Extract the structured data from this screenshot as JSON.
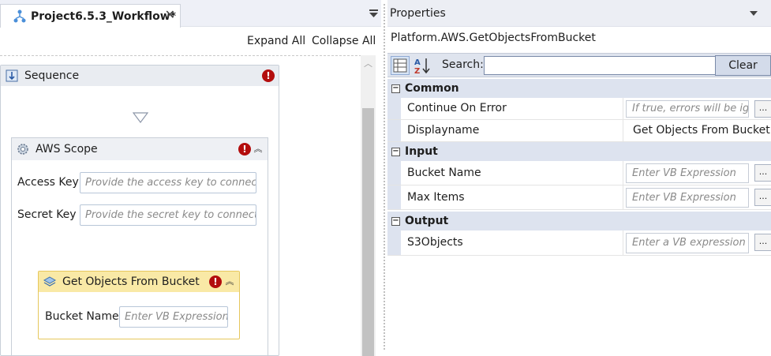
{
  "designer": {
    "tab_title": "Project6.5.3_Workflow*",
    "tab_close": "✕",
    "expand_all": "Expand All",
    "collapse_all": "Collapse All",
    "sequence": {
      "title": "Sequence"
    },
    "aws_scope": {
      "title": "AWS Scope",
      "access_key_label": "Access Key",
      "access_key_placeholder": "Provide the access key to connect",
      "secret_key_label": "Secret Key",
      "secret_key_placeholder": "Provide the secret key to connect"
    },
    "get_objects": {
      "title": "Get Objects From Bucket",
      "bucket_name_label": "Bucket Name",
      "bucket_name_placeholder": "Enter VB Expression"
    }
  },
  "properties": {
    "panel_title": "Properties",
    "activity_type": "Platform.AWS.GetObjectsFromBucket",
    "search_label": "Search:",
    "search_value": "",
    "clear_label": "Clear",
    "ellipsis": "...",
    "categories": {
      "common": {
        "title": "Common",
        "continue_on_error": {
          "name": "Continue On Error",
          "placeholder": "If true, errors will be ignored"
        },
        "displayname": {
          "name": "Displayname",
          "value": "Get Objects From Bucket"
        }
      },
      "input": {
        "title": "Input",
        "bucket_name": {
          "name": "Bucket Name",
          "placeholder": "Enter VB Expression"
        },
        "max_items": {
          "name": "Max Items",
          "placeholder": "Enter VB Expression"
        }
      },
      "output": {
        "title": "Output",
        "s3objects": {
          "name": "S3Objects",
          "placeholder": "Enter a VB expression"
        }
      }
    }
  },
  "colors": {
    "error_red": "#b30d0d",
    "activity_highlight": "#f9e9a6",
    "category_bg": "#dde3ef"
  }
}
